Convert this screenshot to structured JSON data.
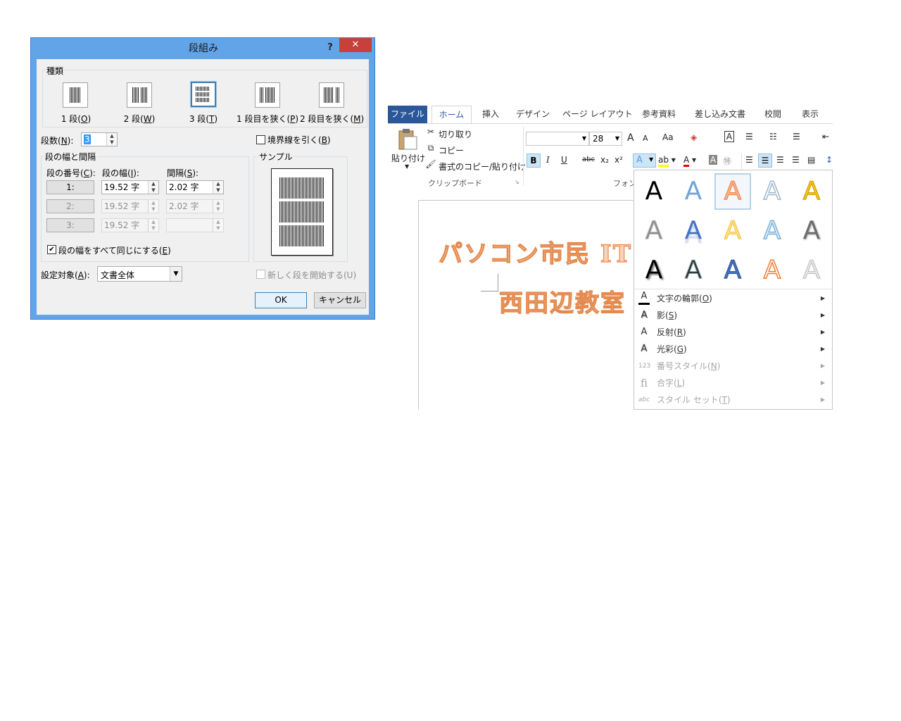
{
  "dialog": {
    "title": "段組み",
    "help": "?",
    "close": "✕",
    "type_group_label": "種類",
    "presets": [
      {
        "label": "1 段(",
        "key": "O",
        "tail": ")"
      },
      {
        "label": "2 段(",
        "key": "W",
        "tail": ")"
      },
      {
        "label": "3 段(",
        "key": "T",
        "tail": ")"
      },
      {
        "label": "1 段目を狭く(",
        "key": "P",
        "tail": ")"
      },
      {
        "label": "2 段目を狭く(",
        "key": "M",
        "tail": ")"
      }
    ],
    "columns_count_label": "段数(",
    "columns_count_key": "N",
    "columns_count_tail": "):",
    "columns_count_value": "3",
    "line_between_label": "境界線を引く(",
    "line_between_key": "B",
    "line_between_tail": ")",
    "width_group_label": "段の幅と間隔",
    "col_header_number": "段の番号(",
    "col_header_number_key": "C",
    "col_header_width": "段の幅(",
    "col_header_width_key": "I",
    "col_header_spacing": "間隔(",
    "col_header_spacing_key": "S",
    "col_header_tail": "):",
    "rows": [
      {
        "num": "1:",
        "width": "19.52 字",
        "spacing": "2.02 字"
      },
      {
        "num": "2:",
        "width": "19.52 字",
        "spacing": "2.02 字"
      },
      {
        "num": "3:",
        "width": "19.52 字",
        "spacing": ""
      }
    ],
    "equal_width_label": "段の幅をすべて同じにする(",
    "equal_width_key": "E",
    "equal_width_tail": ")",
    "equal_width_checked": "✔",
    "sample_label": "サンプル",
    "apply_to_label": "設定対象(",
    "apply_to_key": "A",
    "apply_to_tail": "):",
    "apply_to_value": "文書全体",
    "new_column_label": "新しく段を開始する(U)",
    "ok": "OK",
    "cancel": "キャンセル"
  },
  "word": {
    "tabs": [
      "ファイル",
      "ホーム",
      "挿入",
      "デザイン",
      "ページ レイアウト",
      "参考資料",
      "差し込み文書",
      "校閲",
      "表示"
    ],
    "clipboard": {
      "paste": "貼り付け",
      "cut": "切り取り",
      "copy": "コピー",
      "format_painter": "書式のコピー/貼り付け",
      "group": "クリップボード"
    },
    "font": {
      "size": "28",
      "group": "フォント",
      "grow": "A",
      "shrink": "A",
      "case": "Aa",
      "bold": "B",
      "italic": "I",
      "underline": "U",
      "strike": "abc",
      "sub": "x₂",
      "sup": "x²"
    },
    "doc": {
      "line1": "パソコン市民 IT",
      "line2": "西田辺教室"
    }
  },
  "gallery": {
    "glyph": "A",
    "menu": [
      {
        "icon": "A",
        "label": "文字の輪郭(",
        "key": "O",
        "tail": ")",
        "enabled": true
      },
      {
        "icon": "A",
        "label": "影(",
        "key": "S",
        "tail": ")",
        "enabled": true
      },
      {
        "icon": "A",
        "label": "反射(",
        "key": "R",
        "tail": ")",
        "enabled": true
      },
      {
        "icon": "A",
        "label": "光彩(",
        "key": "G",
        "tail": ")",
        "enabled": true
      },
      {
        "icon": "123",
        "label": "番号スタイル(",
        "key": "N",
        "tail": ")",
        "enabled": false
      },
      {
        "icon": "fi",
        "label": "合字(",
        "key": "L",
        "tail": ")",
        "enabled": false
      },
      {
        "icon": "abc",
        "label": "スタイル セット(",
        "key": "T",
        "tail": ")",
        "enabled": false
      }
    ]
  },
  "colors": {
    "titlebar": "#62a4e8",
    "close": "#c7413a",
    "file_tab": "#2b579a",
    "wordart_fill": "#fbd3b8",
    "wordart_stroke": "#e58a4e"
  }
}
